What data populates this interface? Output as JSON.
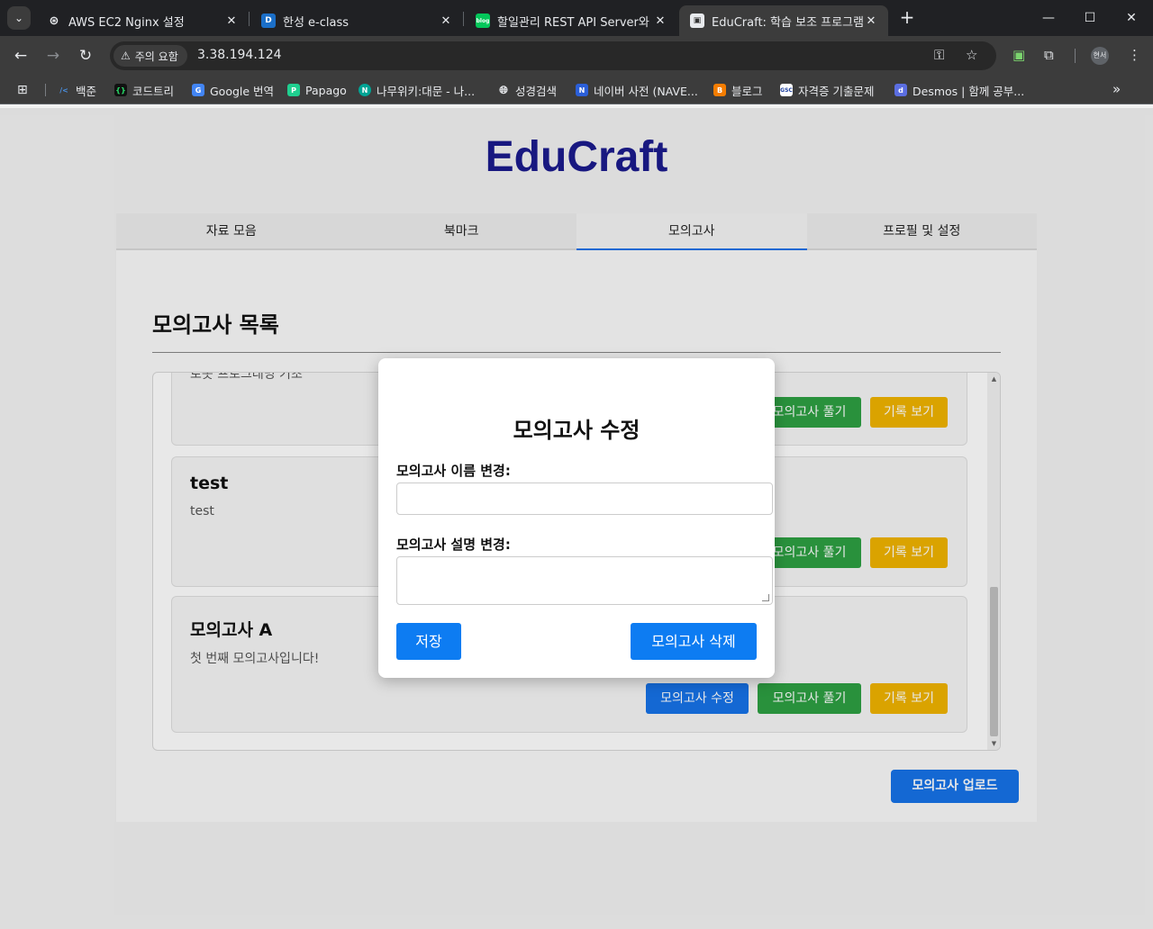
{
  "browser": {
    "tabs": [
      {
        "title": "AWS EC2 Nginx 설정",
        "favicon_icon": "openai-icon",
        "active": false
      },
      {
        "title": "한성 e-class",
        "favicon_icon": "eclass-icon",
        "active": false
      },
      {
        "title": "할일관리 REST API Server와 Cl",
        "favicon_icon": "blog-icon",
        "favicon_text": "blog",
        "active": false
      },
      {
        "title": "EduCraft: 학습 보조 프로그램",
        "favicon_icon": "page-icon",
        "active": true
      }
    ],
    "address": {
      "security_label": "주의 요함",
      "url": "3.38.194.124"
    },
    "profile_label": "현서",
    "bookmarks": [
      {
        "label": "백준",
        "icon": "baekjoon-icon"
      },
      {
        "label": "코드트리",
        "icon": "codetree-icon"
      },
      {
        "label": "Google 번역",
        "icon": "google-translate-icon"
      },
      {
        "label": "Papago",
        "icon": "papago-icon"
      },
      {
        "label": "나무위키:대문 - 나...",
        "icon": "namuwiki-icon"
      },
      {
        "label": "성경검색",
        "icon": "globe-icon"
      },
      {
        "label": "네이버 사전 (NAVE...",
        "icon": "naver-dict-icon"
      },
      {
        "label": "블로그",
        "icon": "blogger-icon"
      },
      {
        "label": "자격증 기출문제",
        "icon": "gsc-icon",
        "icon_text": "GSC"
      },
      {
        "label": "Desmos | 함께 공부...",
        "icon": "desmos-icon",
        "icon_text": "d"
      }
    ]
  },
  "app": {
    "logo": "EduCraft",
    "nav_tabs": [
      "자료 모음",
      "북마크",
      "모의고사",
      "프로필 및 설정"
    ],
    "active_tab": "모의고사",
    "section_title": "모의고사 목록",
    "partial_top_desc": "로봇 프로그래밍 기초",
    "exams": [
      {
        "name": "",
        "desc": ""
      },
      {
        "name": "test",
        "desc": "test"
      },
      {
        "name": "모의고사 A",
        "desc": "첫 번째 모의고사입니다!"
      }
    ],
    "buttons": {
      "edit": "모의고사 수정",
      "solve": "모의고사 풀기",
      "history": "기록 보기",
      "upload": "모의고사 업로드"
    }
  },
  "modal": {
    "title": "모의고사 수정",
    "name_label": "모의고사 이름 변경:",
    "name_value": "",
    "desc_label": "모의고사 설명 변경:",
    "desc_value": "",
    "save": "저장",
    "delete": "모의고사 삭제"
  },
  "colors": {
    "brand": "#1c1b8e",
    "primary": "#1773e8",
    "solve": "#2ea043",
    "history": "#f0b400"
  }
}
